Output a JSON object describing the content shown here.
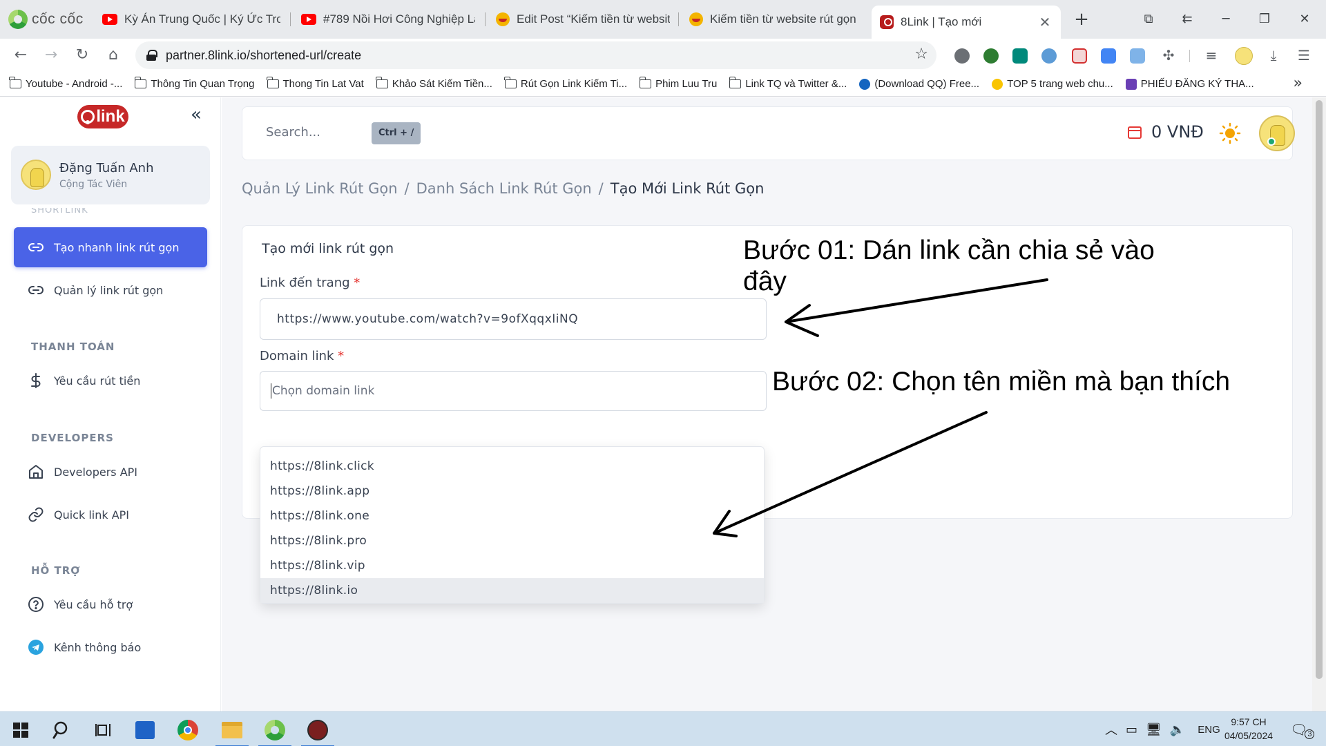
{
  "browser": {
    "brand": "cốc cốc",
    "tabs": [
      {
        "label": "Kỳ Án Trung Quốc | Ký Ức Trong",
        "icon": "youtube-icon"
      },
      {
        "label": "#789 Nồi Hơi Công Nghiệp Là",
        "icon": "youtube-icon"
      },
      {
        "label": "Edit Post “Kiếm tiền từ website",
        "icon": "smile-icon"
      },
      {
        "label": "Kiếm tiền từ website rút gọn lin",
        "icon": "smile-icon"
      },
      {
        "label": "8Link | Tạo mới",
        "icon": "8link-icon",
        "active": true
      }
    ],
    "url": "partner.8link.io/shortened-url/create",
    "bookmarks": [
      {
        "label": "Youtube - Android -...",
        "icon": "folder-icon"
      },
      {
        "label": "Thông Tin Quan Trọng",
        "icon": "folder-icon"
      },
      {
        "label": "Thong Tin Lat Vat",
        "icon": "folder-icon"
      },
      {
        "label": "Khảo Sát Kiếm Tiền...",
        "icon": "folder-icon"
      },
      {
        "label": "Rút Gọn Link Kiếm Ti...",
        "icon": "folder-icon"
      },
      {
        "label": "Phim Luu Tru",
        "icon": "folder-icon"
      },
      {
        "label": "Link TQ và Twitter &...",
        "icon": "folder-icon"
      },
      {
        "label": "(Download QQ) Free...",
        "icon": "qq-icon"
      },
      {
        "label": "TOP 5 trang web chu...",
        "icon": "star-badge-icon"
      },
      {
        "label": "PHIẾU ĐĂNG KÝ THA...",
        "icon": "form-icon"
      }
    ]
  },
  "sidebar": {
    "logo_text": "link",
    "user": {
      "name": "Đặng Tuấn Anh",
      "role": "Cộng Tác Viên"
    },
    "cut_section": "SHORTLINK",
    "items": [
      {
        "label": "Tạo nhanh link rút gọn",
        "icon": "link-icon",
        "active": true
      },
      {
        "label": "Quản lý link rút gọn",
        "icon": "link-icon"
      },
      {
        "label": "Yêu cầu rút tiền",
        "icon": "dollar-icon"
      },
      {
        "label": "Developers API",
        "icon": "home-icon"
      },
      {
        "label": "Quick link API",
        "icon": "chain-icon"
      },
      {
        "label": "Yêu cầu hỗ trợ",
        "icon": "help-circle-icon"
      },
      {
        "label": "Kênh thông báo",
        "icon": "telegram-icon"
      }
    ],
    "sections": [
      "THANH TOÁN",
      "DEVELOPERS",
      "HỖ TRỢ"
    ]
  },
  "topbar": {
    "search_placeholder": "Search...",
    "shortcut": "Ctrl + /",
    "balance": "0 VNĐ"
  },
  "breadcrumb": [
    "Quản Lý Link Rút Gọn",
    "/",
    "Danh Sách Link Rút Gọn",
    "/",
    "Tạo Mới Link Rút Gọn"
  ],
  "form": {
    "title": "Tạo mới link rút gọn",
    "link_label": "Link đến trang",
    "link_value": "https://www.youtube.com/watch?v=9ofXqqxIiNQ",
    "domain_label": "Domain link",
    "domain_placeholder": "Chọn domain link",
    "required_mark": "*",
    "domain_options": [
      "https://8link.click",
      "https://8link.app",
      "https://8link.one",
      "https://8link.pro",
      "https://8link.vip",
      "https://8link.io"
    ],
    "highlighted_option": "https://8link.io"
  },
  "annotations": {
    "step1": "Bước 01: Dán link cần chia sẻ vào đây",
    "step2": "Bước 02: Chọn tên miền mà bạn thích"
  },
  "taskbar": {
    "language": "ENG",
    "time": "9:57 CH",
    "date": "04/05/2024",
    "notification_count": "3"
  },
  "colors": {
    "accent": "#4a63e7",
    "brand_red": "#c62828",
    "required_red": "#e53935",
    "sun": "#f4a300"
  }
}
